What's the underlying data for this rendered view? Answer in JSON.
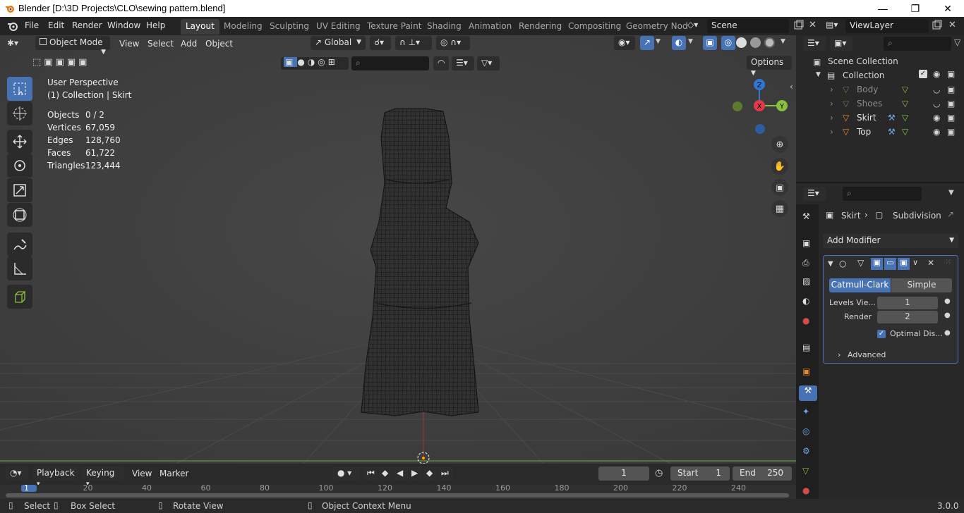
{
  "titlebar": {
    "title": "Blender [D:\\3D Projects\\CLO\\sewing pattern.blend]"
  },
  "menu": [
    "File",
    "Edit",
    "Render",
    "Window",
    "Help"
  ],
  "workspaces": [
    "Layout",
    "Modeling",
    "Sculpting",
    "UV Editing",
    "Texture Paint",
    "Shading",
    "Animation",
    "Rendering",
    "Compositing",
    "Geometry Nod"
  ],
  "scene": {
    "name": "Scene",
    "viewlayer": "ViewLayer"
  },
  "viewport_header": {
    "mode": "Object Mode",
    "menus": [
      "View",
      "Select",
      "Add",
      "Object"
    ],
    "transform": "Global",
    "options": "Options"
  },
  "overlay_text": {
    "perspective": "User Perspective",
    "collection": "(1) Collection | Skirt"
  },
  "stats": [
    {
      "label": "Objects",
      "value": "0 / 2"
    },
    {
      "label": "Vertices",
      "value": "67,059"
    },
    {
      "label": "Edges",
      "value": "128,760"
    },
    {
      "label": "Faces",
      "value": "61,722"
    },
    {
      "label": "Triangles",
      "value": "123,444"
    }
  ],
  "gizmo": {
    "z": "Z",
    "y": "Y",
    "x": "X"
  },
  "outliner": {
    "scene_collection": "Scene Collection",
    "collection": "Collection",
    "items": [
      {
        "name": "Body",
        "visible": false
      },
      {
        "name": "Shoes",
        "visible": false
      },
      {
        "name": "Skirt",
        "visible": true
      },
      {
        "name": "Top",
        "visible": true
      }
    ]
  },
  "properties": {
    "breadcrumb_object": "Skirt",
    "breadcrumb_modifier": "Subdivision",
    "add_modifier": "Add Modifier",
    "type_a": "Catmull-Clark",
    "type_b": "Simple",
    "levels_viewport_label": "Levels Vie...",
    "levels_viewport_value": "1",
    "render_label": "Render",
    "render_value": "2",
    "optimal_display": "Optimal Dis...",
    "advanced": "Advanced"
  },
  "timeline": {
    "playback": "Playback",
    "keying": "Keying",
    "view": "View",
    "marker": "Marker",
    "current_frame": "1",
    "start_label": "Start",
    "start_value": "1",
    "end_label": "End",
    "end_value": "250",
    "ruler": [
      "1",
      "20",
      "40",
      "60",
      "80",
      "100",
      "120",
      "140",
      "160",
      "180",
      "200",
      "220",
      "240"
    ]
  },
  "statusbar": {
    "select": "Select",
    "box_select": "Box Select",
    "rotate_view": "Rotate View",
    "context_menu": "Object Context Menu",
    "version": "3.0.0"
  },
  "colors": {
    "accent": "#4772b3",
    "viewport_bg": "#3d3d3d",
    "x_axis": "#e5394b",
    "y_axis": "#8ac03c",
    "z_axis": "#2f78d1"
  }
}
